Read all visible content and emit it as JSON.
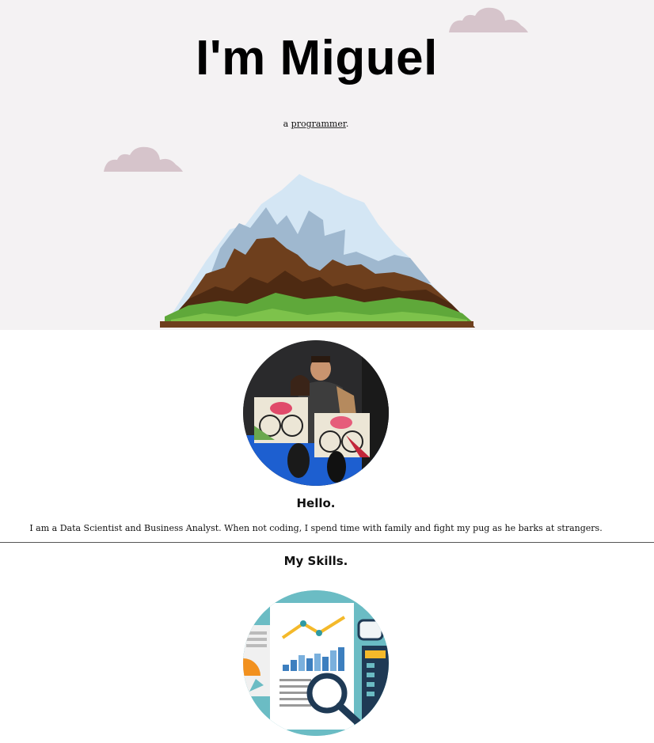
{
  "hero": {
    "title": "I'm Miguel",
    "tagline_prefix": "a ",
    "tagline_word": "programmer",
    "tagline_suffix": "."
  },
  "about": {
    "heading": "Hello.",
    "bio": "I am a Data Scientist and Business Analyst. When not coding, I spend time with family and fight my pug as he barks at strangers."
  },
  "skills": {
    "heading": "My Skills."
  },
  "colors": {
    "hero_bg": "#f4f2f3",
    "cloud": "#d6c4cb",
    "mountain_snow": "#d4e6f4",
    "mountain_brown": "#6e3f1d",
    "grass": "#5fa83a",
    "skills_circle": "#6bbcc4"
  }
}
